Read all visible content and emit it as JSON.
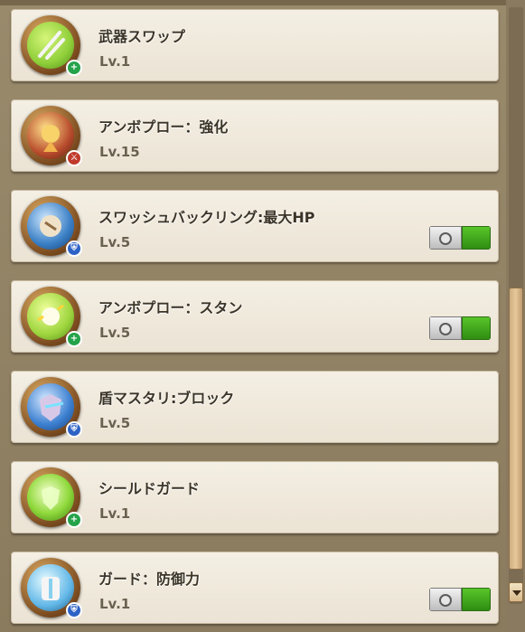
{
  "skills": [
    {
      "name": "武器スワップ",
      "level": "Lv.1",
      "toggle": false,
      "core": "#8fcf3a",
      "badge_color": "#24a34a",
      "badge": "+",
      "icon": "weapon-swap-icon"
    },
    {
      "name": "アンボプロー：強化",
      "level": "Lv.15",
      "toggle": false,
      "core": "#b84c2d",
      "badge_color": "#c0392b",
      "badge": "⚔",
      "icon": "ambo-blow-enhance-icon"
    },
    {
      "name": "スワッシュバックリング:最大HP",
      "level": "Lv.5",
      "toggle": true,
      "core": "#3a7fc5",
      "badge_color": "#2e63c6",
      "badge": "⛨",
      "icon": "swashbuckling-hp-icon"
    },
    {
      "name": "アンボプロー：スタン",
      "level": "Lv.5",
      "toggle": true,
      "core": "#9ed53e",
      "badge_color": "#24a34a",
      "badge": "+",
      "icon": "ambo-blow-stun-icon"
    },
    {
      "name": "盾マスタリ:ブロック",
      "level": "Lv.5",
      "toggle": false,
      "core": "#3b7fd0",
      "badge_color": "#2e63c6",
      "badge": "⛨",
      "icon": "shield-mastery-block-icon"
    },
    {
      "name": "シールドガード",
      "level": "Lv.1",
      "toggle": false,
      "core": "#8fd93b",
      "badge_color": "#24a34a",
      "badge": "+",
      "icon": "shield-guard-icon"
    },
    {
      "name": "ガード：防御力",
      "level": "Lv.1",
      "toggle": true,
      "core": "#63b8e8",
      "badge_color": "#2e63c6",
      "badge": "⛨",
      "icon": "guard-defense-icon"
    }
  ]
}
